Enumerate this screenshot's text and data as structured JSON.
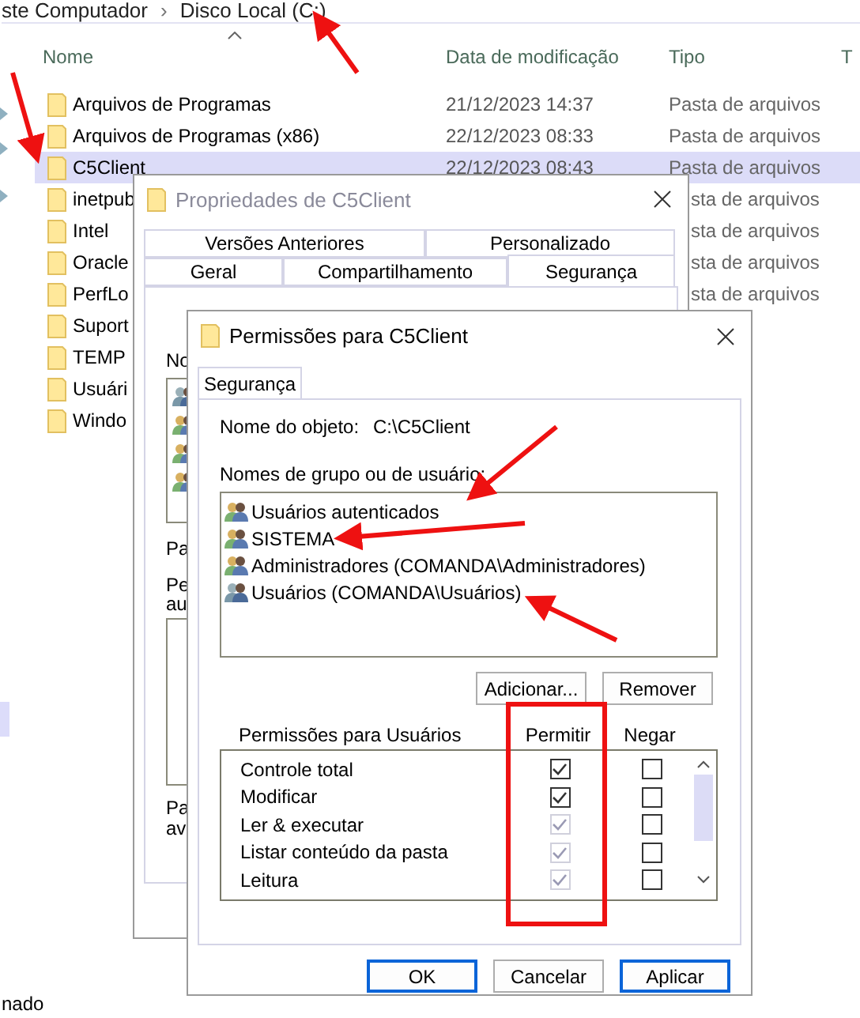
{
  "explorer": {
    "breadcrumb": [
      "ste Computador",
      "Disco Local (C:)"
    ],
    "separator": "›",
    "columns": [
      "Nome",
      "Data de modificação",
      "Tipo",
      "T"
    ],
    "rows": [
      {
        "name": "Arquivos de Programas",
        "date": "21/12/2023 14:37",
        "type": "Pasta de arquivos",
        "selected": false
      },
      {
        "name": "Arquivos de Programas (x86)",
        "date": "22/12/2023 08:33",
        "type": "Pasta de arquivos",
        "selected": false
      },
      {
        "name": "C5Client",
        "date": "22/12/2023 08:43",
        "type": "Pasta de arquivos",
        "selected": true
      },
      {
        "name": "inetpub",
        "type_partial": "sta de arquivos",
        "selected": false
      },
      {
        "name": "Intel",
        "type_partial": "sta de arquivos",
        "selected": false
      },
      {
        "name": "Oracle",
        "type_partial": "sta de arquivos",
        "selected": false
      },
      {
        "name": "PerfLo",
        "type_partial": "sta de arquivos",
        "selected": false
      },
      {
        "name": "Suport",
        "selected": false
      },
      {
        "name": "TEMP",
        "selected": false
      },
      {
        "name": "Usuári",
        "selected": false
      },
      {
        "name": "Windo",
        "selected": false
      }
    ],
    "nav_fragment": "nado"
  },
  "properties_dialog": {
    "title": "Propriedades de C5Client",
    "tab_rows": [
      [
        {
          "label": "Versões Anteriores",
          "selected": false
        },
        {
          "label": "Personalizado",
          "selected": false
        }
      ],
      [
        {
          "label": "Geral",
          "selected": false
        },
        {
          "label": "Compartilhamento",
          "selected": false
        },
        {
          "label": "Segurança",
          "selected": true
        }
      ]
    ],
    "fragments": {
      "object": "No",
      "permissions_header": "Pa",
      "permissions_note": [
        "Pe",
        "au"
      ],
      "advanced_header": "Pa",
      "advanced_note": "av"
    }
  },
  "permissions_dialog": {
    "title": "Permissões para C5Client",
    "tab": {
      "label": "Segurança",
      "selected": true
    },
    "object_label": "Nome do objeto:",
    "object_value": "C:\\C5Client",
    "groups_label": "Nomes de grupo ou de usuário:",
    "groups": [
      {
        "name": "Usuários autenticados",
        "selected": false
      },
      {
        "name": "SISTEMA",
        "selected": false
      },
      {
        "name": "Administradores (COMANDA\\Administradores)",
        "selected": false
      },
      {
        "name": "Usuários (COMANDA\\Usuários)",
        "selected": false
      }
    ],
    "group_buttons": [
      "Adicionar...",
      "Remover"
    ],
    "permissions_label": "Permissões para Usuários",
    "columns": [
      "Permitir",
      "Negar"
    ],
    "permissions": [
      {
        "name": "Controle total",
        "allow": {
          "checked": true,
          "disabled": false
        },
        "deny": {
          "checked": false,
          "disabled": false
        }
      },
      {
        "name": "Modificar",
        "allow": {
          "checked": true,
          "disabled": false
        },
        "deny": {
          "checked": false,
          "disabled": false
        }
      },
      {
        "name": "Ler & executar",
        "allow": {
          "checked": true,
          "disabled": true
        },
        "deny": {
          "checked": false,
          "disabled": false
        }
      },
      {
        "name": "Listar conteúdo da pasta",
        "allow": {
          "checked": true,
          "disabled": true
        },
        "deny": {
          "checked": false,
          "disabled": false
        }
      },
      {
        "name": "Leitura",
        "allow": {
          "checked": true,
          "disabled": true
        },
        "deny": {
          "checked": false,
          "disabled": false
        }
      }
    ],
    "footer_buttons": [
      "OK",
      "Cancelar",
      "Aplicar"
    ]
  }
}
